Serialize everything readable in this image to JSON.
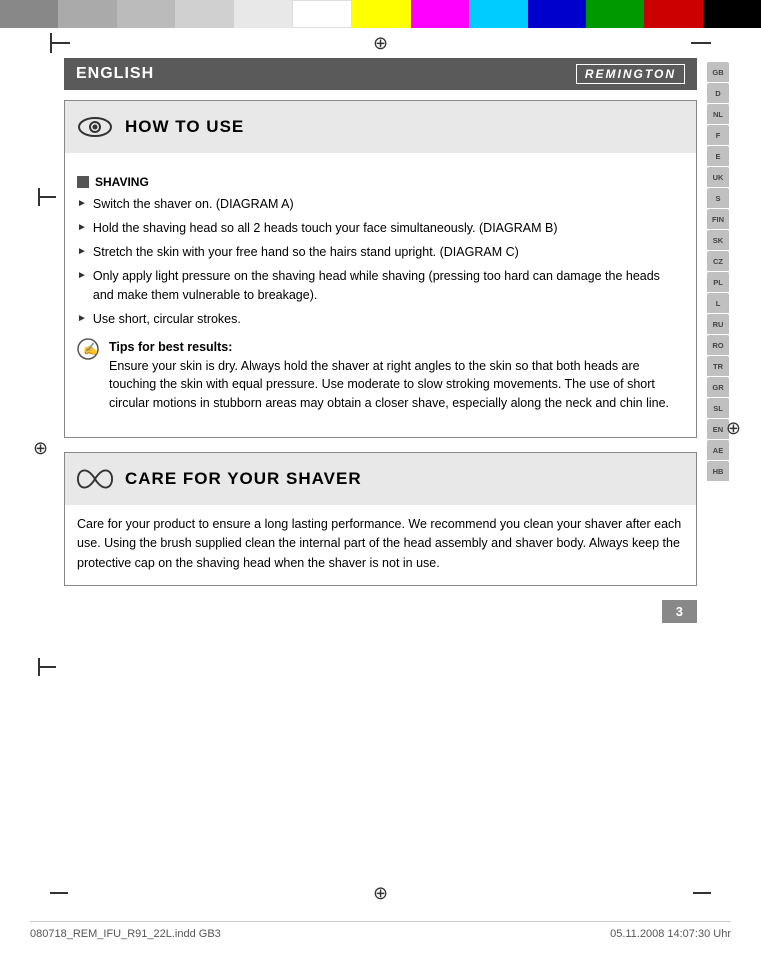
{
  "color_bar": {
    "segments": [
      {
        "color": "#888888",
        "label": "gray-dark"
      },
      {
        "color": "#aaaaaa",
        "label": "gray-medium"
      },
      {
        "color": "#c0c0c0",
        "label": "gray-light"
      },
      {
        "color": "#d8d8d8",
        "label": "gray-lighter"
      },
      {
        "color": "#eeeeee",
        "label": "gray-lightest"
      },
      {
        "color": "#ffffff",
        "label": "white"
      },
      {
        "color": "#ffff00",
        "label": "yellow"
      },
      {
        "color": "#ff00ff",
        "label": "magenta"
      },
      {
        "color": "#00bfff",
        "label": "cyan"
      },
      {
        "color": "#0000cc",
        "label": "blue"
      },
      {
        "color": "#009900",
        "label": "green"
      },
      {
        "color": "#cc0000",
        "label": "red"
      },
      {
        "color": "#000000",
        "label": "black"
      }
    ]
  },
  "header": {
    "language": "ENGLISH",
    "brand": "REMINGTON"
  },
  "tabs": {
    "items": [
      "GB",
      "D",
      "NL",
      "F",
      "E",
      "UK",
      "S",
      "FIN",
      "SK",
      "CZ",
      "PL",
      "L",
      "RU",
      "RO",
      "TR",
      "GR",
      "SL",
      "EN",
      "AE",
      "HB"
    ]
  },
  "how_to_use": {
    "title": "HOW TO USE",
    "icon_label": "eye-icon",
    "shaving_header": "SHAVING",
    "bullets": [
      "Switch the shaver on. (DIAGRAM A)",
      "Hold the shaving head so all 2 heads touch your face simultaneously. (DIAGRAM B)",
      "Stretch the skin with your free hand so the hairs stand upright. (DIAGRAM C)",
      "Only apply light pressure on the shaving head while shaving (pressing too hard can damage the heads and make them vulnerable to breakage).",
      "Use short, circular strokes."
    ],
    "tips_title": "Tips for best results:",
    "tips_body": "Ensure your skin is dry. Always hold the shaver at right angles to the skin so that both heads are touching the skin with equal pressure. Use moderate to slow stroking movements. The use of short circular motions in stubborn areas may obtain a closer shave, especially along the neck and chin line."
  },
  "care_for_shaver": {
    "title": "CARE FOR YOUR SHAVER",
    "icon_label": "infinity-icon",
    "body": "Care for your product to ensure a long lasting performance. We recommend you clean your shaver after each use. Using the brush supplied clean the internal part of the head assembly and shaver body. Always keep the protective cap on the shaving head when the shaver is not in use."
  },
  "page": {
    "number": "3"
  },
  "footer": {
    "left": "080718_REM_IFU_R91_22L.indd   GB3",
    "right": "05.11.2008   14:07:30 Uhr"
  }
}
